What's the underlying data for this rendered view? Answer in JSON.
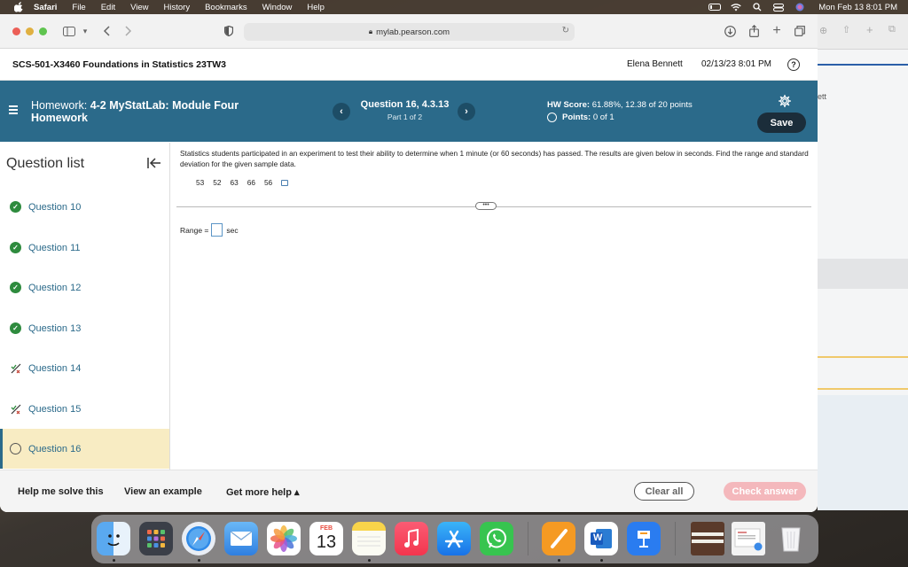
{
  "menubar": {
    "items": [
      "Safari",
      "File",
      "Edit",
      "View",
      "History",
      "Bookmarks",
      "Window",
      "Help"
    ],
    "datetime": "Mon Feb 13  8:01 PM"
  },
  "browser": {
    "url": "mylab.pearson.com"
  },
  "header": {
    "course": "SCS-501-X3460 Foundations in Statistics 23TW3",
    "user": "Elena Bennett",
    "date": "02/13/23 8:01 PM",
    "help_icon": "?"
  },
  "hwbar": {
    "prefix": "Homework: ",
    "title": "4-2 MyStatLab: Module Four",
    "title_line2": "Homework",
    "question_title": "Question 16, 4.3.13",
    "question_part": "Part 1 of 2",
    "score_label": "HW Score:",
    "score_value": "61.88%, 12.38 of 20 points",
    "points_label": "Points:",
    "points_value": "0 of 1",
    "save_label": "Save",
    "prev_icon": "‹",
    "next_icon": "›"
  },
  "sidebar": {
    "title": "Question list",
    "items": [
      {
        "label": "Question 10",
        "status": "done"
      },
      {
        "label": "Question 11",
        "status": "done"
      },
      {
        "label": "Question 12",
        "status": "done"
      },
      {
        "label": "Question 13",
        "status": "done"
      },
      {
        "label": "Question 14",
        "status": "partial"
      },
      {
        "label": "Question 15",
        "status": "partial"
      },
      {
        "label": "Question 16",
        "status": "current"
      }
    ]
  },
  "question": {
    "prompt": "Statistics students participated in an experiment to test their ability to determine when 1 minute (or 60 seconds) has passed. The results are given below in seconds. Find the range and standard deviation for the given sample data.",
    "data": [
      "53",
      "52",
      "63",
      "66",
      "56"
    ],
    "more_label": "•••",
    "answer_label": "Range =",
    "answer_unit": "sec",
    "answer_value": ""
  },
  "footer": {
    "help_solve": "Help me solve this",
    "view_example": "View an example",
    "more_help": "Get more help ▴",
    "clear_all": "Clear all",
    "check_answer": "Check answer"
  },
  "background_window": {
    "fragment": "ett"
  },
  "dock": {
    "calendar_month": "FEB",
    "calendar_day": "13",
    "word_letter": "W"
  },
  "colors": {
    "hw_bar": "#2b6a8a",
    "done_green": "#2e8b3e",
    "active_row": "#f8ecc3",
    "check_answer_disabled": "#f4b8bc"
  }
}
